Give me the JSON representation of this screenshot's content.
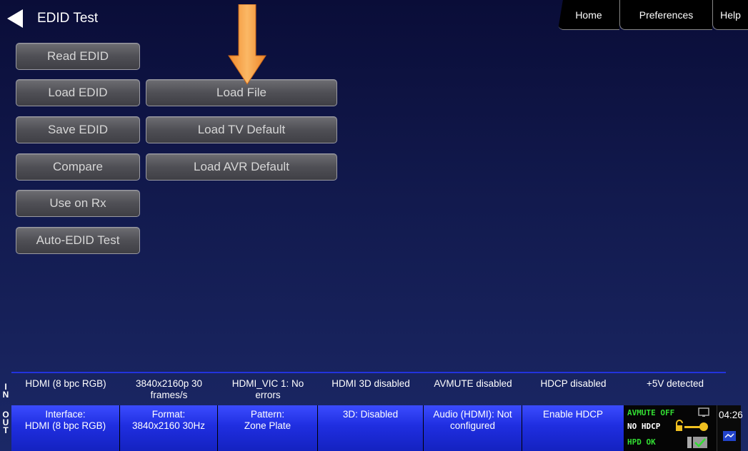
{
  "header": {
    "title": "EDID Test",
    "tabs": [
      "Home",
      "Preferences",
      "Help"
    ]
  },
  "buttons": {
    "read_edid": "Read EDID",
    "load_edid": "Load EDID",
    "save_edid": "Save EDID",
    "compare": "Compare",
    "use_on_rx": "Use on Rx",
    "auto_edid_test": "Auto-EDID Test",
    "load_file": "Load File",
    "load_tv_default": "Load TV Default",
    "load_avr_default": "Load AVR Default"
  },
  "status_in": {
    "label": "IN",
    "cells": [
      [
        "HDMI (8 bpc RGB)"
      ],
      [
        "3840x2160p 30",
        "frames/s"
      ],
      [
        "HDMI_VIC 1: No",
        "errors"
      ],
      [
        "HDMI 3D disabled"
      ],
      [
        "AVMUTE disabled"
      ],
      [
        "HDCP disabled"
      ],
      [
        "+5V detected"
      ]
    ]
  },
  "status_out": {
    "label": "OUT",
    "cells": [
      [
        "Interface:",
        "HDMI (8 bpc RGB)"
      ],
      [
        "Format:",
        "3840x2160 30Hz"
      ],
      [
        "Pattern:",
        "Zone Plate"
      ],
      [
        "3D: Disabled"
      ],
      [
        "Audio (HDMI): Not",
        "configured"
      ],
      [
        "Enable HDCP"
      ]
    ]
  },
  "indicators": {
    "avmute": "AVMUTE OFF",
    "hdcp": "NO HDCP",
    "hpd": "HPD OK",
    "time": "04:26"
  },
  "colors": {
    "accent_arrow": "#f7a44a",
    "status_green": "#33dd33",
    "out_bar": "#2233dd"
  }
}
